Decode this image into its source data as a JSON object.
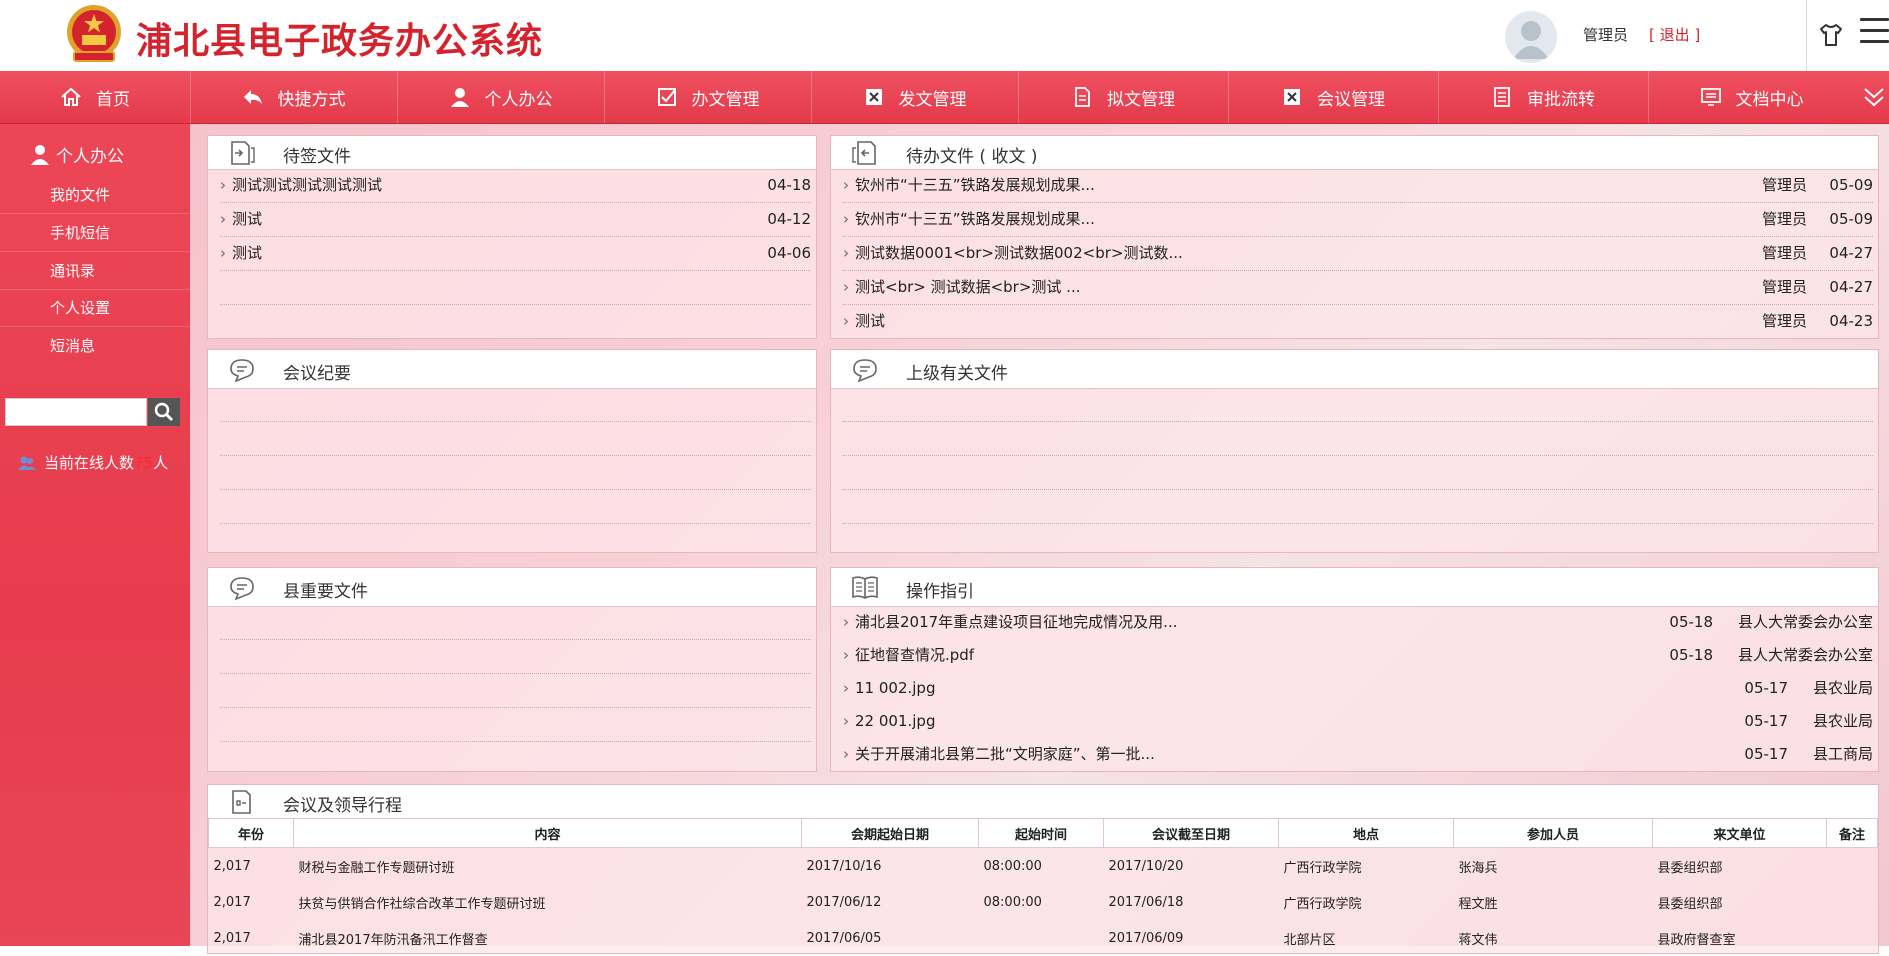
{
  "header": {
    "title": "浦北县电子政务办公系统",
    "user": "管理员",
    "logout": "[ 退出 ]"
  },
  "nav": [
    {
      "label": "首页",
      "icon": "home-icon"
    },
    {
      "label": "快捷方式",
      "icon": "reply-icon"
    },
    {
      "label": "个人办公",
      "icon": "user-icon"
    },
    {
      "label": "办文管理",
      "icon": "checkbox-icon"
    },
    {
      "label": "发文管理",
      "icon": "close-box-icon"
    },
    {
      "label": "拟文管理",
      "icon": "document-edit-icon"
    },
    {
      "label": "会议管理",
      "icon": "close-box-icon"
    },
    {
      "label": "审批流转",
      "icon": "document-list-icon"
    },
    {
      "label": "文档中心",
      "icon": "monitor-icon"
    }
  ],
  "sidebar": {
    "heading": "个人办公",
    "items": [
      "我的文件",
      "手机短信",
      "通讯录",
      "个人设置",
      "短消息"
    ],
    "online_prefix": "当前在线人数",
    "online_count": "75",
    "online_suffix": "人"
  },
  "panels": {
    "pending_sign": {
      "title": "待签文件",
      "rows": [
        {
          "text": "测试测试测试测试测试",
          "date": "04-18"
        },
        {
          "text": "测试",
          "date": "04-12"
        },
        {
          "text": "测试",
          "date": "04-06"
        }
      ]
    },
    "pending_todo": {
      "title": "待办文件 ( 收文 )",
      "rows": [
        {
          "text": "钦州市“十三五”铁路发展规划成果...",
          "who": "管理员",
          "date": "05-09"
        },
        {
          "text": "钦州市“十三五”铁路发展规划成果...",
          "who": "管理员",
          "date": "05-09"
        },
        {
          "text": "测试数据0001<br>测试数据002<br>测试数...",
          "who": "管理员",
          "date": "04-27"
        },
        {
          "text": "测试<br> 测试数据<br>测试 ...",
          "who": "管理员",
          "date": "04-27"
        },
        {
          "text": "测试",
          "who": "管理员",
          "date": "04-23"
        }
      ]
    },
    "meeting_minutes": {
      "title": "会议纪要"
    },
    "superior_docs": {
      "title": "上级有关文件"
    },
    "county_docs": {
      "title": "县重要文件"
    },
    "guide": {
      "title": "操作指引",
      "rows": [
        {
          "text": "浦北县2017年重点建设项目征地完成情况及用...",
          "date": "05-18",
          "unit": "县人大常委会办公室"
        },
        {
          "text": "征地督查情况.pdf",
          "date": "05-18",
          "unit": "县人大常委会办公室"
        },
        {
          "text": "11 002.jpg",
          "date": "05-17",
          "unit": "县农业局"
        },
        {
          "text": "22 001.jpg",
          "date": "05-17",
          "unit": "县农业局"
        },
        {
          "text": "关于开展浦北县第二批“文明家庭”、第一批...",
          "date": "05-17",
          "unit": "县工商局"
        }
      ]
    },
    "schedule": {
      "title": "会议及领导行程",
      "columns": [
        "年份",
        "内容",
        "会期起始日期",
        "起始时间",
        "会议截至日期",
        "地点",
        "参加人员",
        "来文单位",
        "备注"
      ],
      "rows": [
        [
          "2,017",
          "财税与金融工作专题研讨班",
          "2017/10/16",
          "08:00:00",
          "2017/10/20",
          "广西行政学院",
          "张海兵",
          "县委组织部",
          ""
        ],
        [
          "2,017",
          "扶贫与供销合作社综合改革工作专题研讨班",
          "2017/06/12",
          "08:00:00",
          "2017/06/18",
          "广西行政学院",
          "程文胜",
          "县委组织部",
          ""
        ],
        [
          "2,017",
          "浦北县2017年防汛备汛工作督查",
          "2017/06/05",
          "",
          "2017/06/09",
          "北部片区",
          "蒋文伟",
          "县政府督查室",
          ""
        ]
      ]
    }
  }
}
